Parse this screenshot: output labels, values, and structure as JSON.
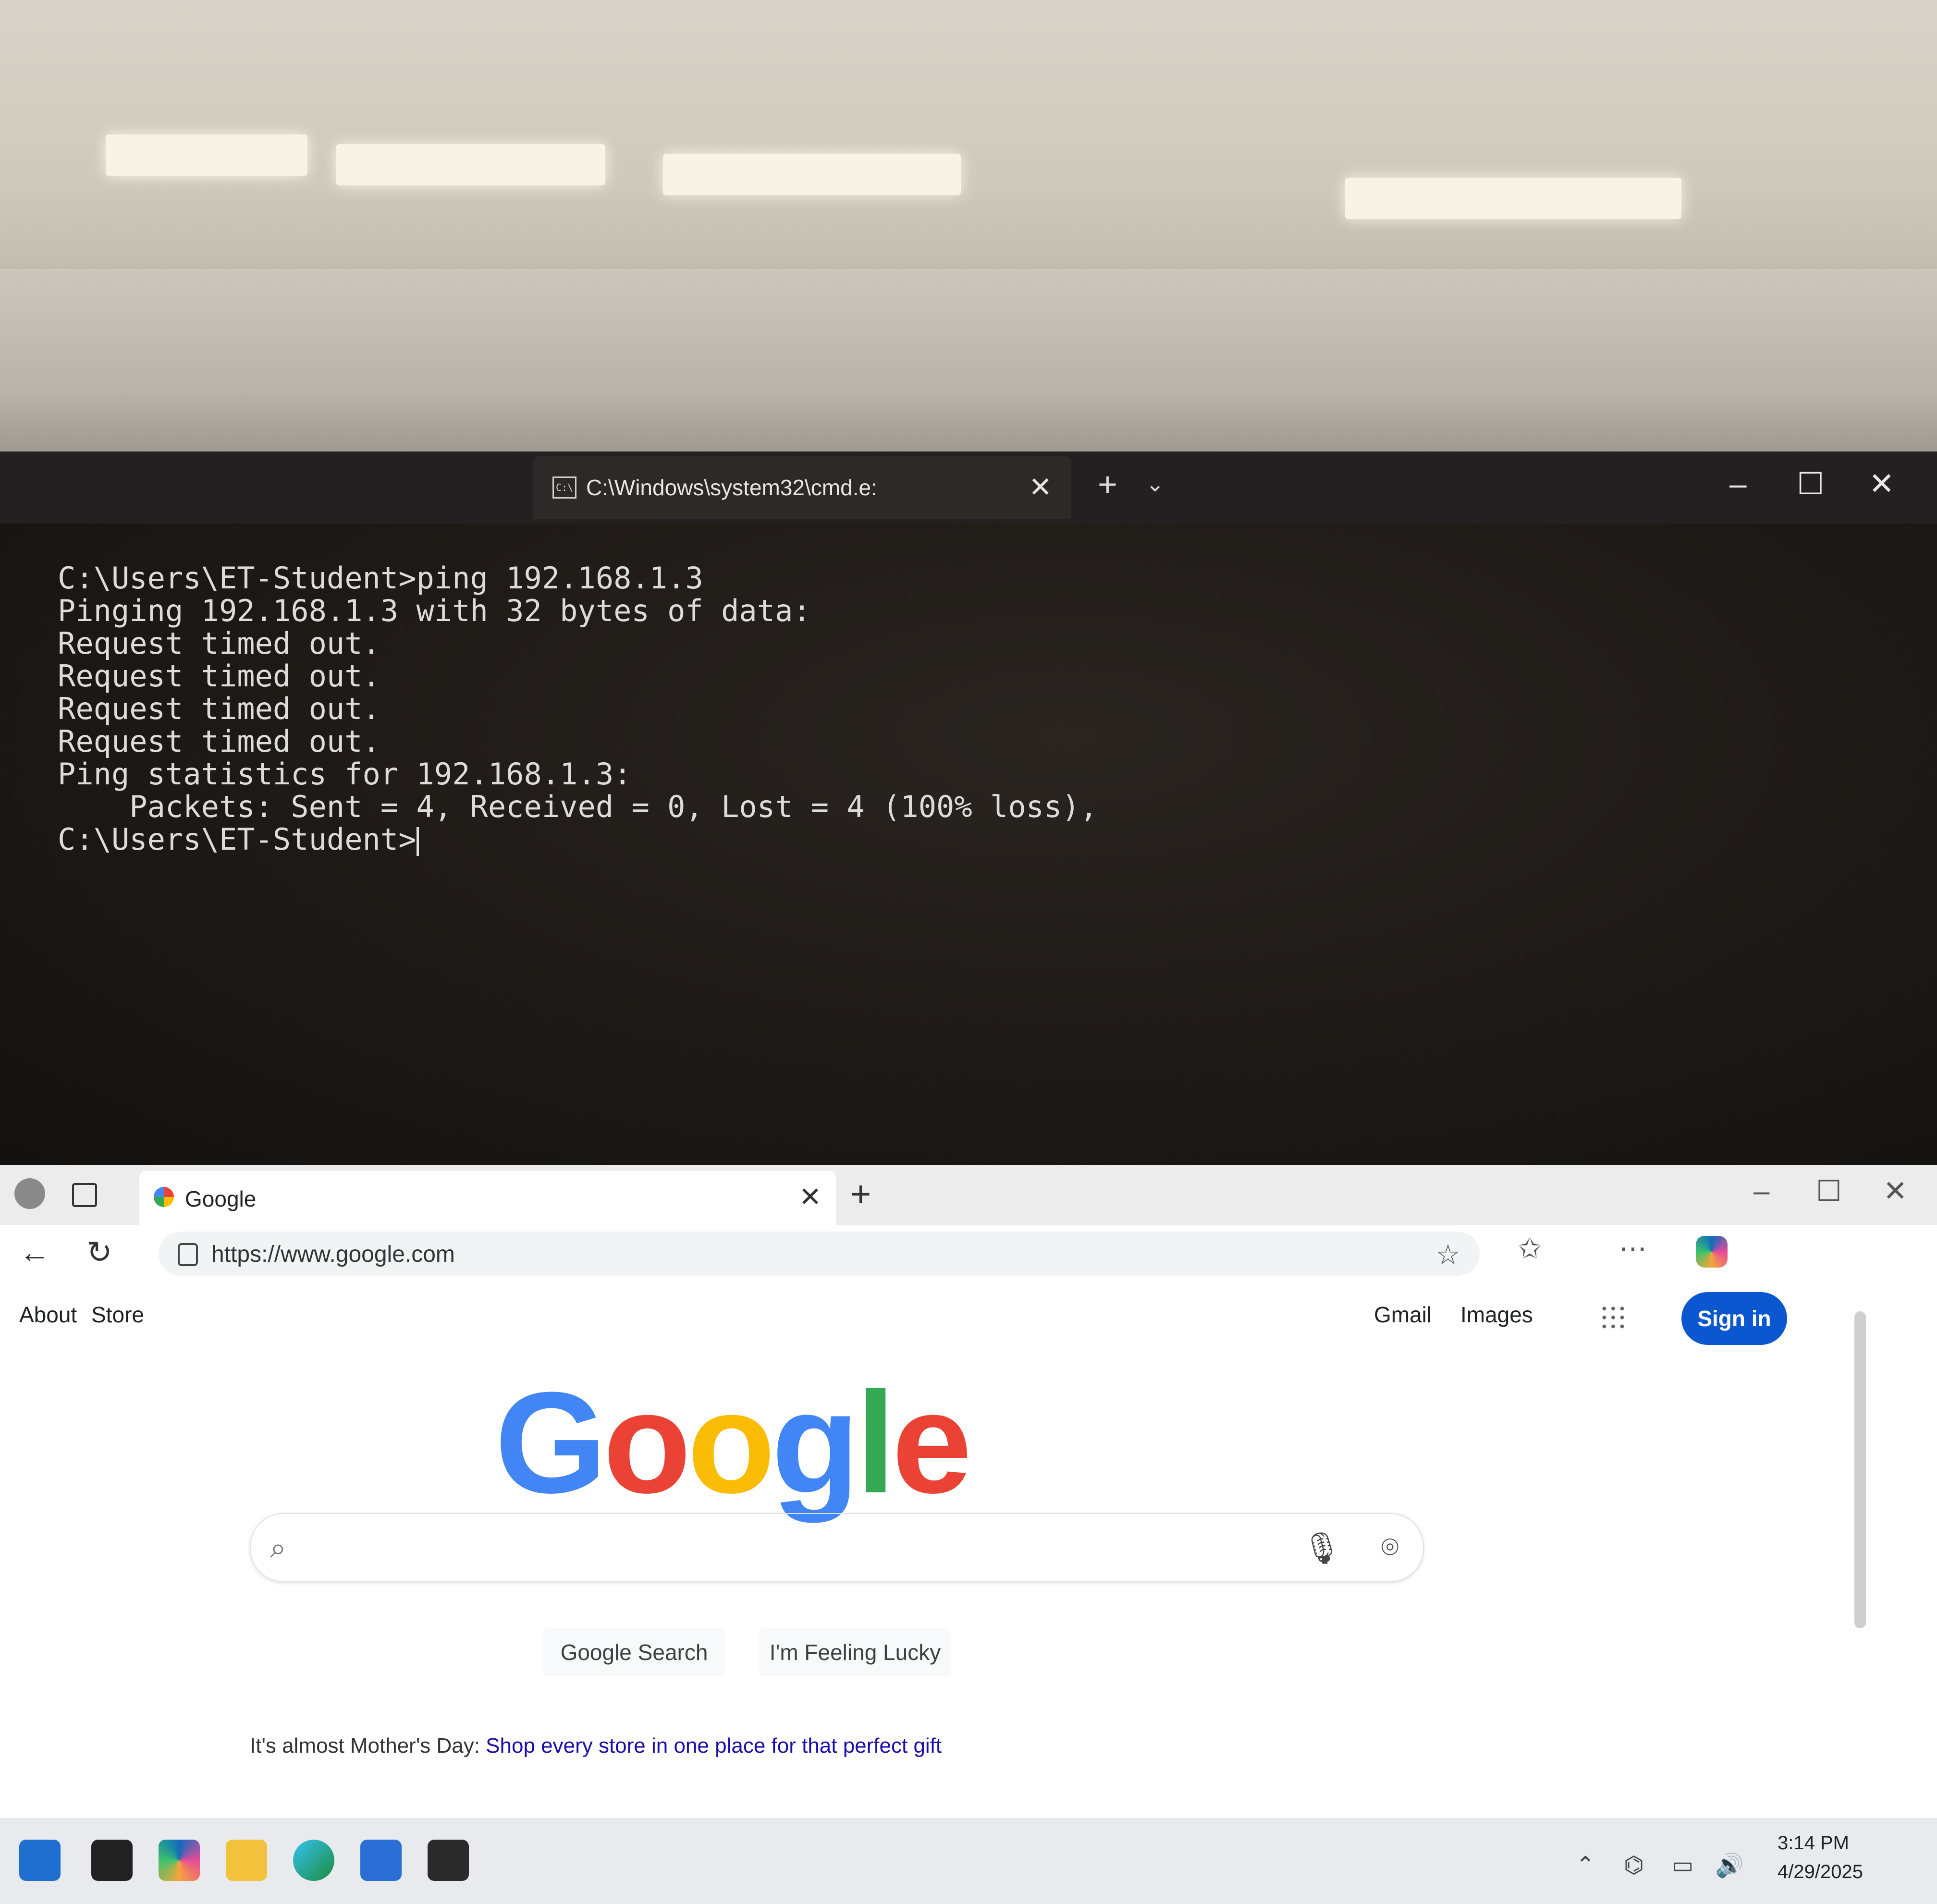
{
  "terminal": {
    "tab_title": "C:\\Windows\\system32\\cmd.e:",
    "tab_icon": "C:\\",
    "lines": [
      "C:\\Users\\ET-Student>ping 192.168.1.3",
      "",
      "Pinging 192.168.1.3 with 32 bytes of data:",
      "Request timed out.",
      "Request timed out.",
      "Request timed out.",
      "Request timed out.",
      "",
      "Ping statistics for 192.168.1.3:",
      "    Packets: Sent = 4, Received = 0, Lost = 4 (100% loss),",
      "",
      "C:\\Users\\ET-Student>"
    ],
    "icons": [
      "close-icon",
      "plus-icon",
      "chevron-down-icon",
      "minimize-icon",
      "maximize-icon"
    ]
  },
  "browser": {
    "tab_title": "Google",
    "url": "https://www.google.com",
    "top_links": {
      "about": "About",
      "store": "Store",
      "gmail": "Gmail",
      "images": "Images"
    },
    "sign_in": "Sign in",
    "logo_letters": [
      "G",
      "o",
      "o",
      "g",
      "l",
      "e"
    ],
    "buttons": {
      "search": "Google Search",
      "lucky": "I'm Feeling Lucky"
    },
    "promo_prefix": "It's almost Mother's Day: ",
    "promo_link": "Shop every store in one place for that perfect gift",
    "colors": {
      "blue": "#4285f4",
      "red": "#ea4335",
      "yellow": "#fbbc05",
      "green": "#34a853",
      "sign_in_bg": "#0b57d0"
    }
  },
  "taskbar": {
    "time": "3:14 PM",
    "date": "4/29/2025"
  }
}
